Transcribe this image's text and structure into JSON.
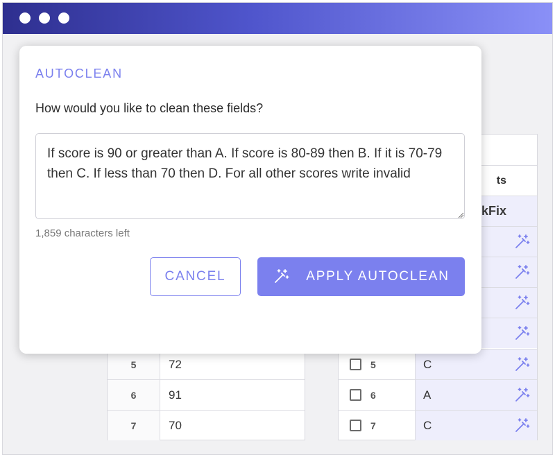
{
  "window": {
    "controls": [
      "dot",
      "dot",
      "dot"
    ]
  },
  "left_table": {
    "rows": [
      {
        "num": "5",
        "value": "72"
      },
      {
        "num": "6",
        "value": "91"
      },
      {
        "num": "7",
        "value": "70"
      }
    ]
  },
  "right_table": {
    "header_partial": "ts",
    "fix_header_partial": "kFix",
    "rows": [
      {
        "num": "5",
        "grade": "C"
      },
      {
        "num": "6",
        "grade": "A"
      },
      {
        "num": "7",
        "grade": "C"
      }
    ],
    "wand_icon": "magic-wand-icon"
  },
  "modal": {
    "title": "AUTOCLEAN",
    "question": "How would you like to clean these fields?",
    "input_value": "If score is 90 or greater than A. If score is 80-89 then B. If it is 70-79 then C. If less than 70 then D. For all other scores write invalid",
    "char_count": "1,859 characters left",
    "cancel_label": "CANCEL",
    "apply_label": "APPLY AUTOCLEAN",
    "apply_icon": "magic-wand-icon"
  },
  "colors": {
    "accent": "#7b80ee",
    "titlebar_start": "#2e2f8f",
    "titlebar_end": "#8a90f7",
    "fix_column_bg": "#eeeefc"
  }
}
